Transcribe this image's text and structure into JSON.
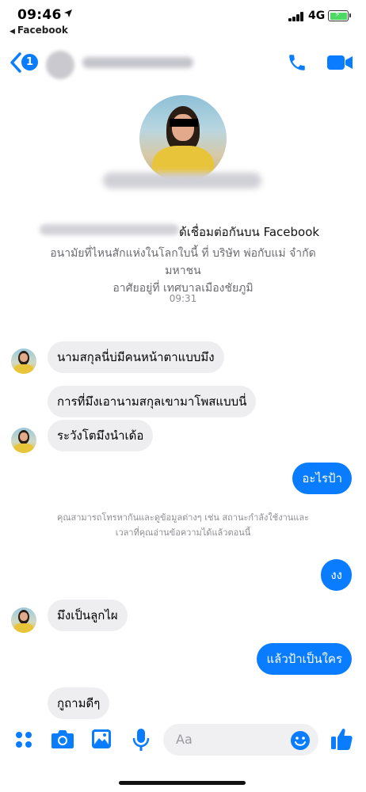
{
  "status_bar": {
    "time": "09:46",
    "back_app": "Facebook",
    "network": "4G",
    "icons": [
      "location-arrow-icon",
      "signal-icon",
      "battery-charging-icon"
    ]
  },
  "header": {
    "unread_count": "1",
    "icons": [
      "back-chevron-icon",
      "phone-icon",
      "video-camera-icon"
    ],
    "accent_color": "#0a7cff"
  },
  "profile": {
    "connected_text": "ด้เชื่อมต่อกันบน Facebook",
    "info_lines": [
      "อนามัยที่ไหนสักแห่งในโลกใบนี้ ที่ บริษัท พ่อกับแม่ จำกัด",
      "มหาชน",
      "อาศัยอยู่ที่ เทศบาลเมืองชัยภูมิ"
    ]
  },
  "conversation": {
    "timestamp": "09:31",
    "messages": [
      {
        "from": "them",
        "text": "นามสกุลนี่บ่มีคนหน้าตาแบบมึง"
      },
      {
        "from": "them",
        "text": "การที่มึงเอานามสกุลเขามาโพสแบบนี่"
      },
      {
        "from": "them",
        "text": "ระวังโตมึงนำเด้อ"
      },
      {
        "from": "me",
        "text": "อะไรป้า"
      },
      {
        "from": "me",
        "text": "งง"
      },
      {
        "from": "them",
        "text": "มึงเป็นลูกไผ"
      },
      {
        "from": "me",
        "text": "แล้วป้าเป็นใคร"
      },
      {
        "from": "them",
        "text": "กูถามดีๆ"
      }
    ],
    "notice_lines": [
      "คุณสามารถโทรหากันและดูข้อมูลต่างๆ เช่น สถานะกำลังใช้งานและ",
      "เวลาที่คุณอ่านข้อความได้แล้วตอนนี้"
    ]
  },
  "composer": {
    "placeholder": "Aa",
    "icons": [
      "menu-dots-icon",
      "camera-icon",
      "photo-icon",
      "microphone-icon",
      "emoji-icon",
      "thumbs-up-icon"
    ]
  }
}
